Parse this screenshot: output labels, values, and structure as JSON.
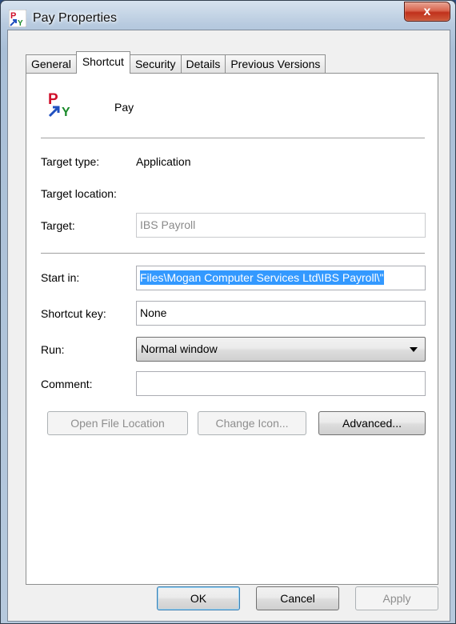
{
  "window": {
    "title": "Pay Properties",
    "close_glyph": "x"
  },
  "tabs": [
    {
      "label": "General"
    },
    {
      "label": "Shortcut"
    },
    {
      "label": "Security"
    },
    {
      "label": "Details"
    },
    {
      "label": "Previous Versions"
    }
  ],
  "active_tab": "Shortcut",
  "shortcut": {
    "name": "Pay",
    "icon": "pay-app-icon",
    "target_type_label": "Target type:",
    "target_type_value": "Application",
    "target_location_label": "Target location:",
    "target_label": "Target:",
    "target_value": "IBS Payroll",
    "start_in_label": "Start in:",
    "start_in_value": "Files\\Mogan Computer Services Ltd\\IBS Payroll\\\"",
    "shortcut_key_label": "Shortcut key:",
    "shortcut_key_value": "None",
    "run_label": "Run:",
    "run_value": "Normal window",
    "comment_label": "Comment:",
    "comment_value": "",
    "open_file_location_label": "Open File Location",
    "change_icon_label": "Change Icon...",
    "advanced_label": "Advanced..."
  },
  "footer": {
    "ok_label": "OK",
    "cancel_label": "Cancel",
    "apply_label": "Apply"
  },
  "colors": {
    "selection": "#3399ff",
    "close_button": "#c0311c",
    "panel": "#ffffff"
  }
}
